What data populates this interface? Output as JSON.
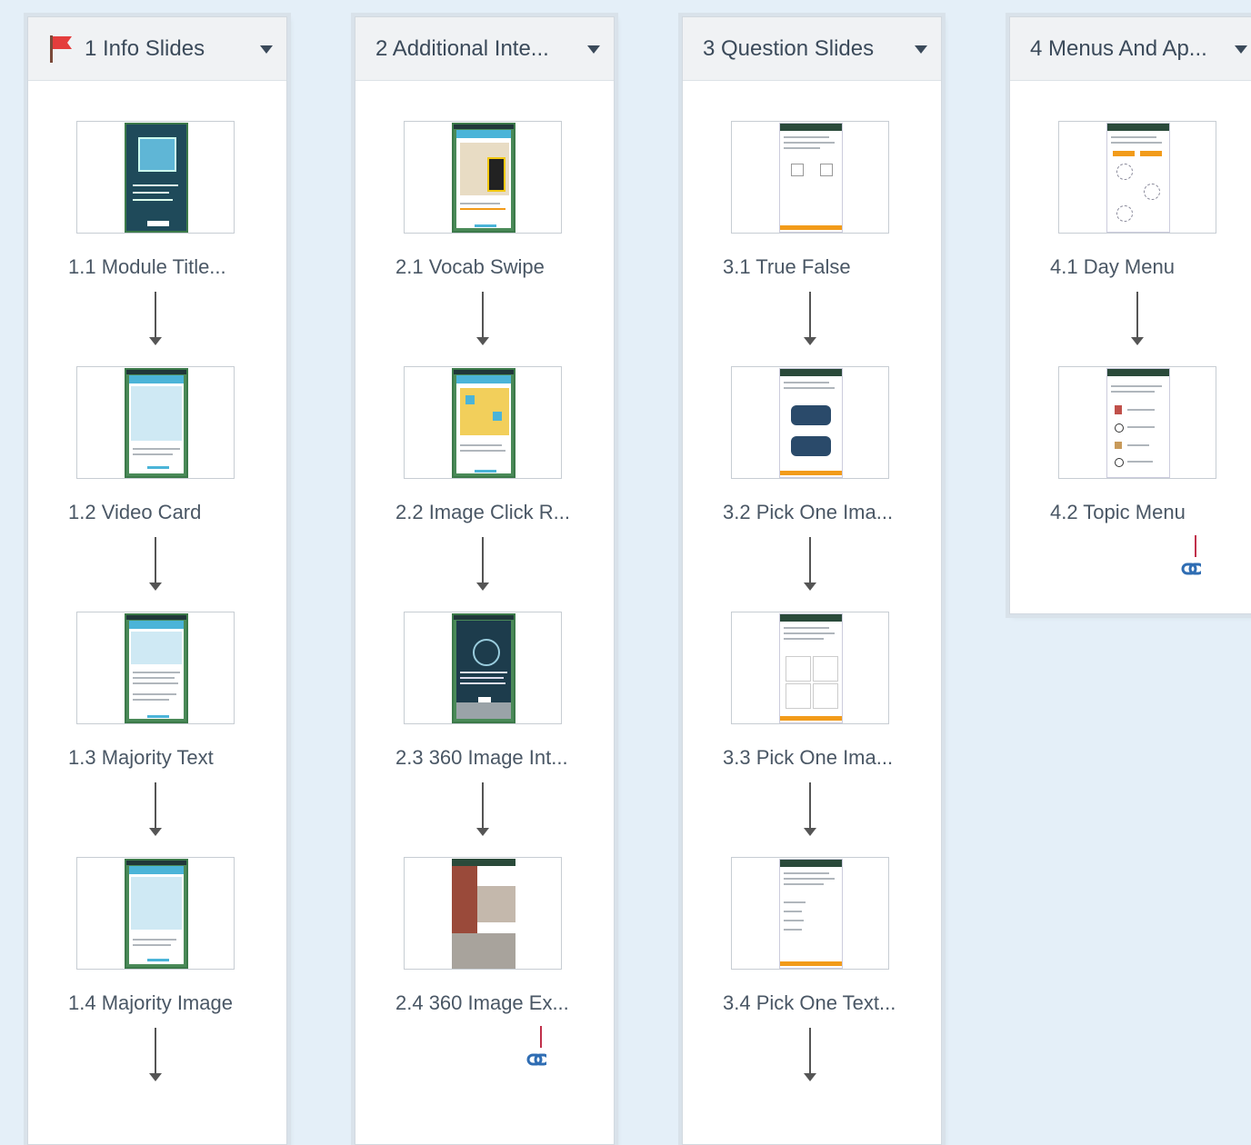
{
  "columns": [
    {
      "title": "1 Info Slides",
      "flag": true,
      "slides": [
        {
          "label": "1.1 Module Title..."
        },
        {
          "label": "1.2 Video Card"
        },
        {
          "label": "1.3 Majority Text"
        },
        {
          "label": "1.4 Majority Image"
        }
      ]
    },
    {
      "title": "2  Additional  Inte...",
      "flag": false,
      "slides": [
        {
          "label": "2.1 Vocab Swipe"
        },
        {
          "label": "2.2 Image Click R..."
        },
        {
          "label": "2.3 360 Image Int..."
        },
        {
          "label": "2.4 360 Image Ex..."
        }
      ]
    },
    {
      "title": "3  Question Slides",
      "flag": false,
      "slides": [
        {
          "label": "3.1 True False"
        },
        {
          "label": "3.2 Pick One Ima..."
        },
        {
          "label": "3.3 Pick One Ima..."
        },
        {
          "label": "3.4 Pick One Text..."
        }
      ]
    },
    {
      "title": "4  Menus  And  Ap...",
      "flag": false,
      "slides": [
        {
          "label": "4.1 Day Menu"
        },
        {
          "label": "4.2 Topic Menu"
        }
      ]
    }
  ],
  "colors": {
    "background": "#e4eff8",
    "flag": "#e43d3d",
    "link": "#2f6db3",
    "phone_frame": "#4a8a58",
    "phone_header": "#4bb4d8",
    "question_button": "#f29b1a"
  },
  "icons": {
    "flag": "flag-icon",
    "dropdown": "caret-down-icon",
    "next": "arrow-down-icon",
    "branch": "link-icon"
  }
}
